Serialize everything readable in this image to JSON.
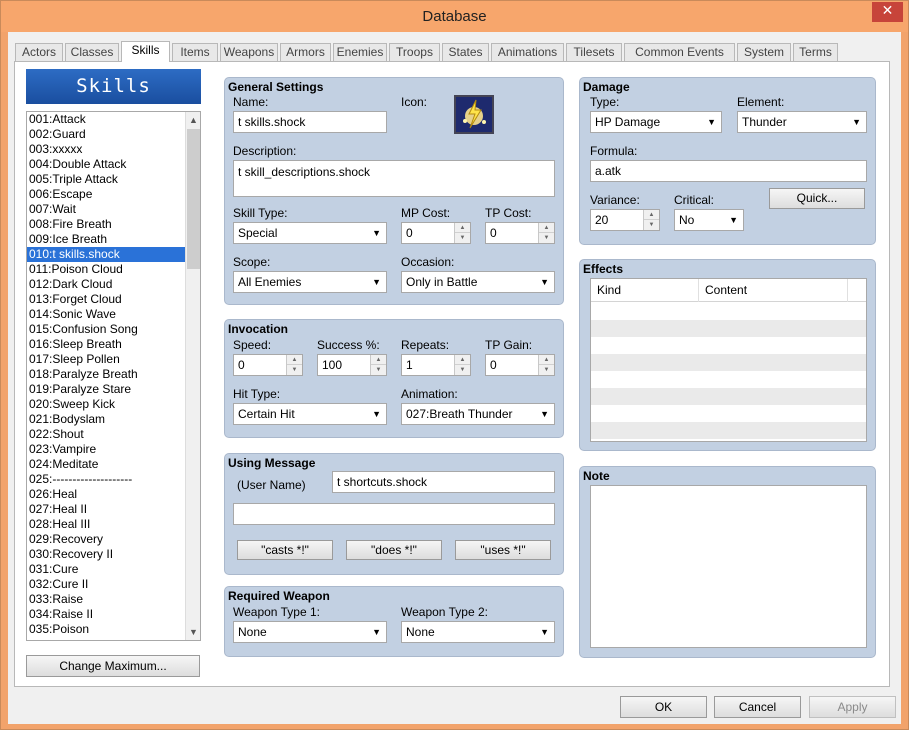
{
  "window": {
    "title": "Database",
    "close_glyph": "✕"
  },
  "tabs": [
    "Actors",
    "Classes",
    "Skills",
    "Items",
    "Weapons",
    "Armors",
    "Enemies",
    "Troops",
    "States",
    "Animations",
    "Tilesets",
    "Common Events",
    "System",
    "Terms"
  ],
  "active_tab": "Skills",
  "left": {
    "header": "Skills",
    "items": [
      "001:Attack",
      "002:Guard",
      "003:xxxxx",
      "004:Double Attack",
      "005:Triple Attack",
      "006:Escape",
      "007:Wait",
      "008:Fire Breath",
      "009:Ice Breath",
      "010:t skills.shock",
      "011:Poison Cloud",
      "012:Dark Cloud",
      "013:Forget Cloud",
      "014:Sonic Wave",
      "015:Confusion Song",
      "016:Sleep Breath",
      "017:Sleep Pollen",
      "018:Paralyze Breath",
      "019:Paralyze Stare",
      "020:Sweep Kick",
      "021:Bodyslam",
      "022:Shout",
      "023:Vampire",
      "024:Meditate",
      "025:--------------------",
      "026:Heal",
      "027:Heal II",
      "028:Heal III",
      "029:Recovery",
      "030:Recovery II",
      "031:Cure",
      "032:Cure II",
      "033:Raise",
      "034:Raise II",
      "035:Poison"
    ],
    "selected_index": 9,
    "change_max_label": "Change Maximum..."
  },
  "general": {
    "title": "General Settings",
    "name_label": "Name:",
    "name_value": "t skills.shock",
    "icon_label": "Icon:",
    "desc_label": "Description:",
    "desc_value": "t skill_descriptions.shock",
    "skill_type_label": "Skill Type:",
    "skill_type_value": "Special",
    "mp_label": "MP Cost:",
    "mp_value": "0",
    "tp_label": "TP Cost:",
    "tp_value": "0",
    "scope_label": "Scope:",
    "scope_value": "All Enemies",
    "occasion_label": "Occasion:",
    "occasion_value": "Only in Battle"
  },
  "invocation": {
    "title": "Invocation",
    "speed_label": "Speed:",
    "speed_value": "0",
    "success_label": "Success %:",
    "success_value": "100",
    "repeats_label": "Repeats:",
    "repeats_value": "1",
    "tpgain_label": "TP Gain:",
    "tpgain_value": "0",
    "hittype_label": "Hit Type:",
    "hittype_value": "Certain Hit",
    "animation_label": "Animation:",
    "animation_value": "027:Breath Thunder"
  },
  "message": {
    "title": "Using Message",
    "user_name_label": "(User Name)",
    "line1_value": "t shortcuts.shock",
    "line2_value": "",
    "btn_casts": "\"casts *!\"",
    "btn_does": "\"does *!\"",
    "btn_uses": "\"uses *!\""
  },
  "weapon": {
    "title": "Required Weapon",
    "type1_label": "Weapon Type 1:",
    "type1_value": "None",
    "type2_label": "Weapon Type 2:",
    "type2_value": "None"
  },
  "damage": {
    "title": "Damage",
    "type_label": "Type:",
    "type_value": "HP Damage",
    "element_label": "Element:",
    "element_value": "Thunder",
    "formula_label": "Formula:",
    "formula_value": "a.atk",
    "variance_label": "Variance:",
    "variance_value": "20",
    "critical_label": "Critical:",
    "critical_value": "No",
    "quick_label": "Quick..."
  },
  "effects": {
    "title": "Effects",
    "col_kind": "Kind",
    "col_content": "Content"
  },
  "note": {
    "title": "Note"
  },
  "footer": {
    "ok": "OK",
    "cancel": "Cancel",
    "apply": "Apply"
  },
  "colors": {
    "accent": "#2a72d8",
    "panel": "#c2d0e2",
    "titlebar": "#f7a66c",
    "close": "#c7443a"
  }
}
